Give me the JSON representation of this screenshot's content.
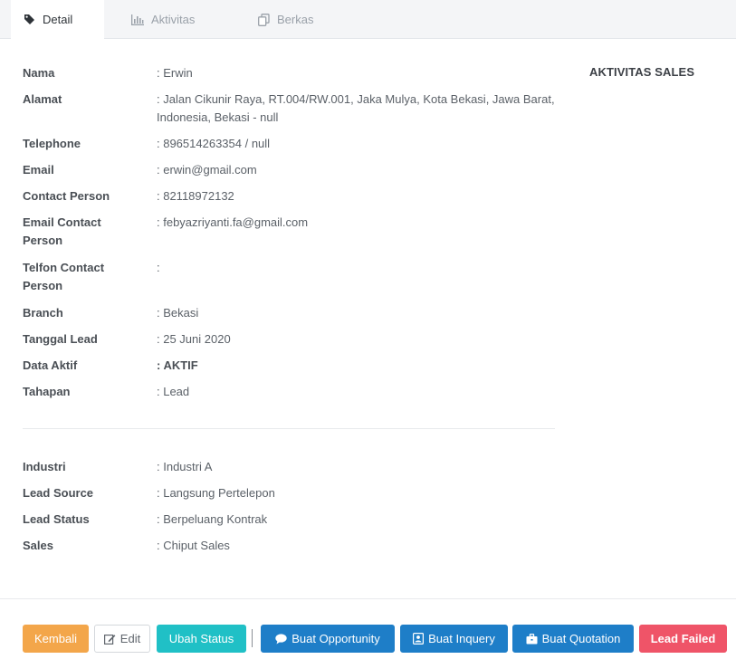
{
  "tabs": [
    {
      "label": "Detail",
      "icon": "tag-icon",
      "active": true
    },
    {
      "label": "Aktivitas",
      "icon": "bar-chart-icon",
      "active": false
    },
    {
      "label": "Berkas",
      "icon": "files-icon",
      "active": false
    }
  ],
  "detail": [
    {
      "label": "Nama",
      "value": ": Erwin"
    },
    {
      "label": "Alamat",
      "value": ": Jalan Cikunir Raya, RT.004/RW.001, Jaka Mulya, Kota Bekasi, Jawa Barat, Indonesia, Bekasi - null"
    },
    {
      "label": "Telephone",
      "value": ": 896514263354 / null"
    },
    {
      "label": "Email",
      "value": ": erwin@gmail.com"
    },
    {
      "label": "Contact Person",
      "value": ": 82118972132"
    },
    {
      "label": "Email Contact Person",
      "value": ": febyazriyanti.fa@gmail.com"
    },
    {
      "label": "Telfon Contact Person",
      "value": ":"
    },
    {
      "label": "Branch",
      "value": ": Bekasi"
    },
    {
      "label": "Tanggal Lead",
      "value": ": 25 Juni 2020"
    },
    {
      "label": "Data Aktif",
      "value": ": AKTIF"
    },
    {
      "label": "Tahapan",
      "value": ": Lead"
    }
  ],
  "extra": [
    {
      "label": "Industri",
      "value": ": Industri A"
    },
    {
      "label": "Lead Source",
      "value": ": Langsung Pertelepon"
    },
    {
      "label": "Lead Status",
      "value": ": Berpeluang Kontrak"
    },
    {
      "label": "Sales",
      "value": ": Chiput Sales"
    }
  ],
  "side": {
    "title": "AKTIVITAS SALES"
  },
  "actions": {
    "kembali": "Kembali",
    "edit": "Edit",
    "ubah_status": "Ubah Status",
    "buat_opportunity": "Buat Opportunity",
    "buat_inquery": "Buat Inquery",
    "buat_quotation": "Buat Quotation",
    "lead_failed": "Lead Failed"
  },
  "colors": {
    "kembali": "#f3a64a",
    "ubah_status": "#20c0c6",
    "primary": "#1e7ec8",
    "lead_failed": "#ef5468"
  }
}
